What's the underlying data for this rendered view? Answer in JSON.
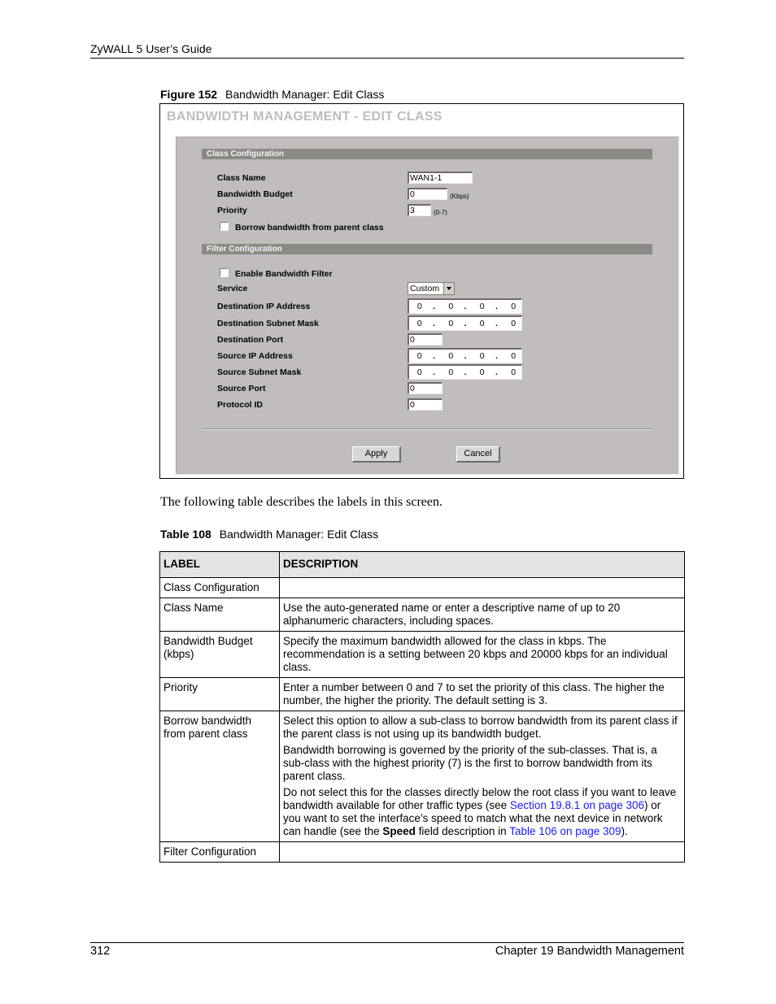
{
  "header": {
    "title": "ZyWALL 5 User’s Guide"
  },
  "figure": {
    "number": "Figure 152",
    "caption": "Bandwidth Manager: Edit Class",
    "screen": {
      "title": "BANDWIDTH MANAGEMENT - EDIT CLASS",
      "class_config": {
        "section_label": "Class Configuration",
        "class_name_label": "Class Name",
        "class_name_value": "WAN1-1",
        "bandwidth_budget_label": "Bandwidth Budget",
        "bandwidth_budget_value": "0",
        "bandwidth_unit": "(Kbps)",
        "priority_label": "Priority",
        "priority_value": "3",
        "priority_range": "(0-7)",
        "borrow_label": "Borrow bandwidth from parent class",
        "borrow_checked": false
      },
      "filter_config": {
        "section_label": "Filter Configuration",
        "enable_label": "Enable Bandwidth Filter",
        "enable_checked": false,
        "service_label": "Service",
        "service_value": "Custom",
        "dest_ip_label": "Destination IP Address",
        "dest_ip": [
          "0",
          "0",
          "0",
          "0"
        ],
        "dest_mask_label": "Destination Subnet Mask",
        "dest_mask": [
          "0",
          "0",
          "0",
          "0"
        ],
        "dest_port_label": "Destination Port",
        "dest_port_value": "0",
        "src_ip_label": "Source IP Address",
        "src_ip": [
          "0",
          "0",
          "0",
          "0"
        ],
        "src_mask_label": "Source Subnet Mask",
        "src_mask": [
          "0",
          "0",
          "0",
          "0"
        ],
        "src_port_label": "Source Port",
        "src_port_value": "0",
        "protocol_label": "Protocol ID",
        "protocol_value": "0"
      },
      "buttons": {
        "apply": "Apply",
        "cancel": "Cancel"
      }
    }
  },
  "intro_text": "The following table describes the labels in this screen.",
  "table": {
    "number": "Table 108",
    "caption": "Bandwidth Manager: Edit Class",
    "headers": [
      "LABEL",
      "DESCRIPTION"
    ],
    "rows": [
      {
        "label": "Class Configuration",
        "desc": []
      },
      {
        "label": "Class Name",
        "desc": [
          "Use the auto-generated name or enter a descriptive name of up to 20 alphanumeric characters, including spaces."
        ]
      },
      {
        "label": "Bandwidth Budget (kbps)",
        "desc": [
          "Specify the maximum bandwidth allowed for the class in kbps. The recommendation is a setting between 20 kbps and 20000 kbps for an individual class."
        ]
      },
      {
        "label": "Priority",
        "desc": [
          "Enter a number between 0 and 7 to set the priority of this class. The higher the number, the higher the priority. The default setting is 3."
        ]
      },
      {
        "label": "Borrow bandwidth from parent class",
        "desc": [
          "Select this option to allow a sub-class to borrow bandwidth from its parent class if the parent class is not using up its bandwidth budget.",
          "Bandwidth borrowing is governed by the priority of the sub-classes. That is, a sub-class with the highest priority (7) is the first to borrow bandwidth from its parent class."
        ],
        "desc3": {
          "t1": "Do not select this for the classes directly below the root class if you want to leave bandwidth available for other traffic types (see ",
          "link1": "Section 19.8.1 on page 306",
          "t2": ") or you want to set the interface’s speed to match what the next device in network can handle (see the ",
          "bold": "Speed",
          "t3": " field description in ",
          "link2": "Table 106 on page 309",
          "t4": ")."
        }
      },
      {
        "label": "Filter Configuration",
        "desc": []
      }
    ]
  },
  "footer": {
    "page_number": "312",
    "chapter": "Chapter 19 Bandwidth Management"
  },
  "colors": {
    "panel_bg": "#c0bcc0",
    "section_bar": "#888c84",
    "link": "#1a1aff",
    "table_header_bg": "#e4e4e4"
  }
}
